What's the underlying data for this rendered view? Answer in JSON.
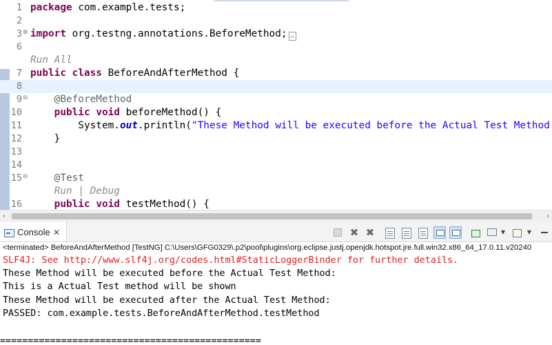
{
  "editor": {
    "lines": [
      {
        "num": "1",
        "segments": [
          {
            "t": "package",
            "c": "kw"
          },
          {
            "t": " com.example.tests;",
            "c": ""
          }
        ]
      },
      {
        "num": "2",
        "segments": []
      },
      {
        "num": "3",
        "fold": "⊕",
        "segments": [
          {
            "t": "import",
            "c": "kw"
          },
          {
            "t": " org.testng.annotations.BeforeMethod;",
            "c": ""
          }
        ],
        "folded_box": "…"
      },
      {
        "num": "6",
        "segments": []
      },
      {
        "num": "",
        "segments": [
          {
            "t": "Run All",
            "c": "mini"
          }
        ]
      },
      {
        "num": "7",
        "segments": [
          {
            "t": "public",
            "c": "kw"
          },
          {
            "t": " ",
            "c": ""
          },
          {
            "t": "class",
            "c": "kw"
          },
          {
            "t": " BeforeAndAfterMethod {",
            "c": ""
          }
        ]
      },
      {
        "num": "8",
        "current": true,
        "segments": []
      },
      {
        "num": "9",
        "fold": "⊖",
        "segments": [
          {
            "t": "    ",
            "c": ""
          },
          {
            "t": "@BeforeMethod",
            "c": "ann"
          }
        ]
      },
      {
        "num": "10",
        "segments": [
          {
            "t": "    ",
            "c": ""
          },
          {
            "t": "public",
            "c": "kw"
          },
          {
            "t": " ",
            "c": ""
          },
          {
            "t": "void",
            "c": "kw"
          },
          {
            "t": " beforeMethod() {",
            "c": ""
          }
        ]
      },
      {
        "num": "11",
        "segments": [
          {
            "t": "        System.",
            "c": ""
          },
          {
            "t": "out",
            "c": "fld"
          },
          {
            "t": ".println(",
            "c": ""
          },
          {
            "t": "\"These Method will be executed before the Actual Test Method:\"",
            "c": "str"
          },
          {
            "t": ");",
            "c": ""
          }
        ]
      },
      {
        "num": "12",
        "segments": [
          {
            "t": "    }",
            "c": ""
          }
        ]
      },
      {
        "num": "13",
        "segments": []
      },
      {
        "num": "14",
        "segments": []
      },
      {
        "num": "15",
        "fold": "⊖",
        "segments": [
          {
            "t": "    ",
            "c": ""
          },
          {
            "t": "@Test",
            "c": "ann"
          }
        ]
      },
      {
        "num": "",
        "segments": [
          {
            "t": "    ",
            "c": ""
          },
          {
            "t": "Run | Debug",
            "c": "mini"
          }
        ]
      },
      {
        "num": "16",
        "segments": [
          {
            "t": "    ",
            "c": ""
          },
          {
            "t": "public",
            "c": "kw"
          },
          {
            "t": " ",
            "c": ""
          },
          {
            "t": "void",
            "c": "kw"
          },
          {
            "t": " testMethod() {",
            "c": ""
          }
        ]
      }
    ]
  },
  "scrollbar": {
    "left_arrow": "‹",
    "right_arrow": "›"
  },
  "console": {
    "tab_label": "Console",
    "close_glyph": "✕",
    "terminated": "<terminated> BeforeAndAfterMethod [TestNG] C:\\Users\\GFG0329\\.p2\\pool\\plugins\\org.eclipse.justj.openjdk.hotspot.jre.full.win32.x86_64_17.0.11.v20240",
    "output": [
      {
        "text": "SLF4J: See http://www.slf4j.org/codes.html#StaticLoggerBinder for further details.",
        "err": true
      },
      {
        "text": "These Method will be executed before the Actual Test Method:",
        "err": false
      },
      {
        "text": "This is a Actual Test method will be shown",
        "err": false
      },
      {
        "text": "These Method will be executed after the Actual Test Method:",
        "err": false
      },
      {
        "text": "PASSED: com.example.tests.BeforeAndAfterMethod.testMethod",
        "err": false
      },
      {
        "text": "",
        "err": false
      }
    ],
    "divider": "==============================================="
  },
  "toolbar": {
    "icons": [
      "stop-icon",
      "remove-launch-icon",
      "remove-all-terminated-icon",
      "scroll-lock-icon",
      "word-wrap-icon",
      "pin-console-icon",
      "show-on-stdout-icon",
      "show-on-stderr-icon",
      "open-console-icon",
      "display-selected-console-icon",
      "new-console-icon",
      "minimize-icon"
    ]
  },
  "colors": {
    "keyword": "#7f0055",
    "string": "#2a00ff",
    "annotation": "#646464",
    "error_output": "#e02020",
    "current_line": "#e8f2fe"
  }
}
